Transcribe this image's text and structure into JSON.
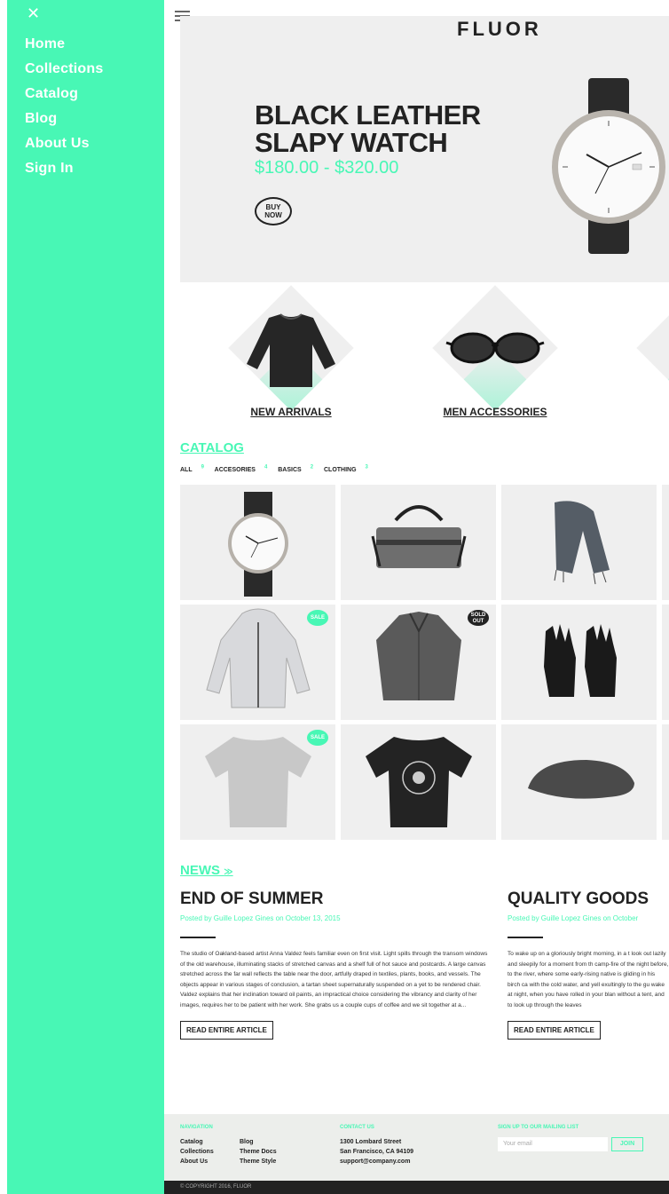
{
  "sidebar": {
    "close_icon": "close-icon",
    "items": [
      {
        "label": "Home"
      },
      {
        "label": "Collections"
      },
      {
        "label": "Catalog"
      },
      {
        "label": "Blog"
      },
      {
        "label": "About Us"
      },
      {
        "label": "Sign In"
      }
    ]
  },
  "header": {
    "logo": "FLUOR"
  },
  "hero": {
    "title_line1": "BLACK LEATHER",
    "title_line2": "SLAPY WATCH",
    "price": "$180.00 - $320.00",
    "buy_line1": "BUY",
    "buy_line2": "NOW"
  },
  "categories": [
    {
      "label": "NEW ARRIVALS"
    },
    {
      "label": "MEN ACCESSORIES"
    }
  ],
  "catalog": {
    "title": "CATALOG",
    "filters": [
      {
        "label": "ALL",
        "count": "9"
      },
      {
        "label": "ACCESORIES",
        "count": "4"
      },
      {
        "label": "BASICS",
        "count": "2"
      },
      {
        "label": "CLOTHING",
        "count": "3"
      }
    ],
    "badges": {
      "sale": "SALE",
      "sold_line1": "SOLD",
      "sold_line2": "OUT"
    }
  },
  "news": {
    "title": "NEWS",
    "articles": [
      {
        "title": "END OF SUMMER",
        "meta": "Posted by Guille Lopez Gines on October 13, 2015",
        "body": "The studio of Oakland-based artist Anna Valdez feels familiar even on first visit. Light spills through the transom windows of the old warehouse, illuminating stacks of stretched canvas and a shelf full of hot sauce and postcards. A large canvas stretched across the far wall reflects the table near the door, artfully draped in textiles, plants, books, and vessels. The objects appear in various stages of conclusion, a tartan sheet supernaturally suspended on a yet to be rendered chair. Valdez explains that her inclination toward oil paints, an impractical choice considering the vibrancy and clarity of her images, requires her to be patient with her work. She grabs us a couple cups of coffee and we sit together at a...",
        "button": "READ ENTIRE ARTICLE"
      },
      {
        "title": "QUALITY GOODS",
        "meta": "Posted by Guille Lopez Gines on October",
        "body": "To wake up on a gloriously bright morning, in a t look out lazily and sleepily for a moment from th camp-fire of the night before, to the river, where some early-rising native is gliding in his birch ca with the cold water, and yell exultingly to the gu wake at night, when you have rolled in your blan without a tent, and to look up through the leaves",
        "button": "READ ENTIRE ARTICLE"
      }
    ]
  },
  "footer": {
    "navigation_title": "NAVIGATION",
    "nav_links": [
      "Catalog",
      "Collections",
      "About Us",
      "Blog",
      "Theme Docs",
      "Theme Style"
    ],
    "contact_title": "CONTACT US",
    "contact_lines": [
      "1300 Lombard Street",
      "San Francisco, CA 94109",
      "support@company.com"
    ],
    "mailing_title": "SIGN UP TO OUR MAILING LIST",
    "email_placeholder": "Your email",
    "join_label": "JOIN",
    "copyright": "© COPYRIGHT 2016, FLUOR"
  },
  "colors": {
    "accent": "#48f7b5",
    "dark": "#222222",
    "panel": "#efefef"
  }
}
